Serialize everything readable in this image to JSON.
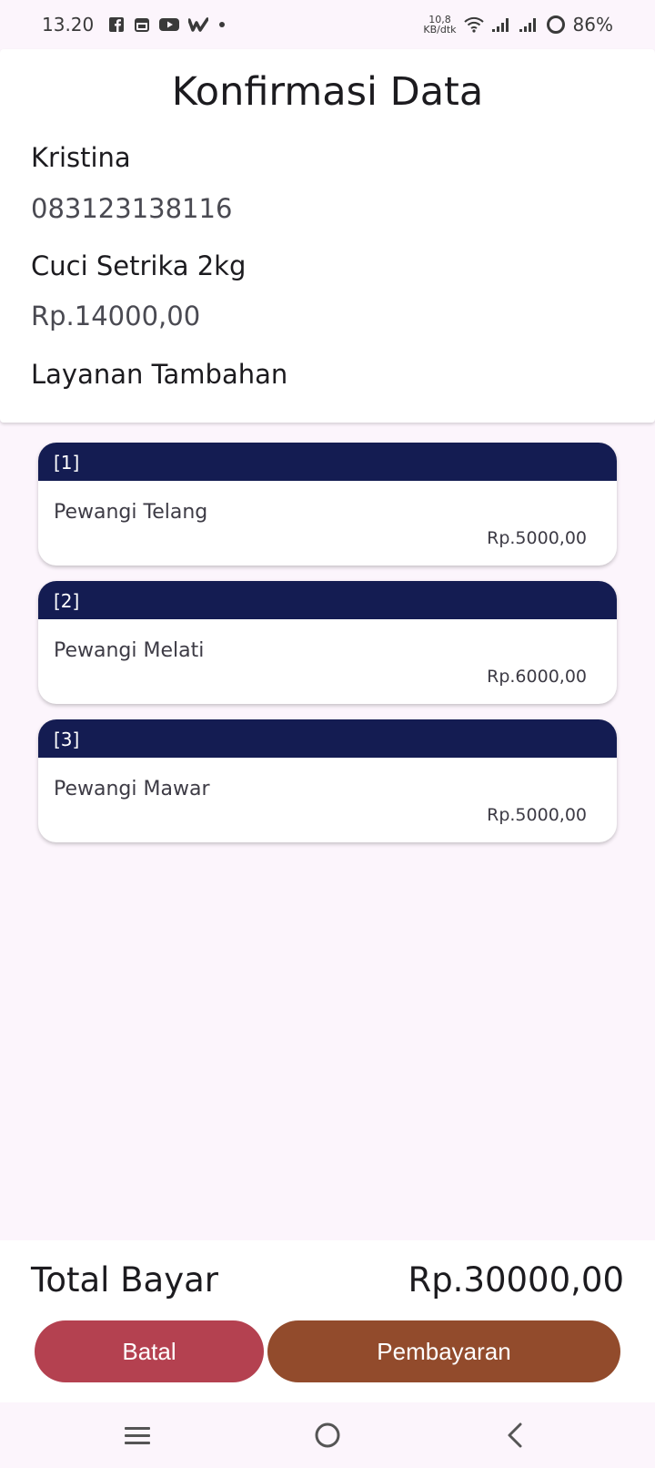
{
  "status_bar": {
    "time": "13.20",
    "net_speed_value": "10,8",
    "net_speed_unit": "KB/dtk",
    "battery": "86%",
    "left_icons": [
      "facebook-icon",
      "calendar-icon",
      "youtube-icon",
      "wattpad-icon",
      "dot-icon"
    ]
  },
  "header": {
    "title": "Konfirmasi Data",
    "customer_name": "Kristina",
    "phone": "083123138116",
    "service_name": "Cuci Setrika 2kg",
    "service_price": "Rp.14000,00",
    "addons_label": "Layanan Tambahan"
  },
  "addons": [
    {
      "index": "[1]",
      "name": "Pewangi Telang",
      "price": "Rp.5000,00"
    },
    {
      "index": "[2]",
      "name": "Pewangi Melati",
      "price": "Rp.6000,00"
    },
    {
      "index": "[3]",
      "name": "Pewangi Mawar",
      "price": "Rp.5000,00"
    }
  ],
  "footer": {
    "total_label": "Total Bayar",
    "total_value": "Rp.30000,00",
    "cancel_label": "Batal",
    "pay_label": "Pembayaran"
  },
  "colors": {
    "addon_header": "#141c52",
    "cancel_button": "#b44150",
    "pay_button": "#924b2c",
    "background": "#fcf5fc"
  },
  "nav_bar": {
    "icons": [
      "menu-icon",
      "home-icon",
      "back-icon"
    ]
  }
}
